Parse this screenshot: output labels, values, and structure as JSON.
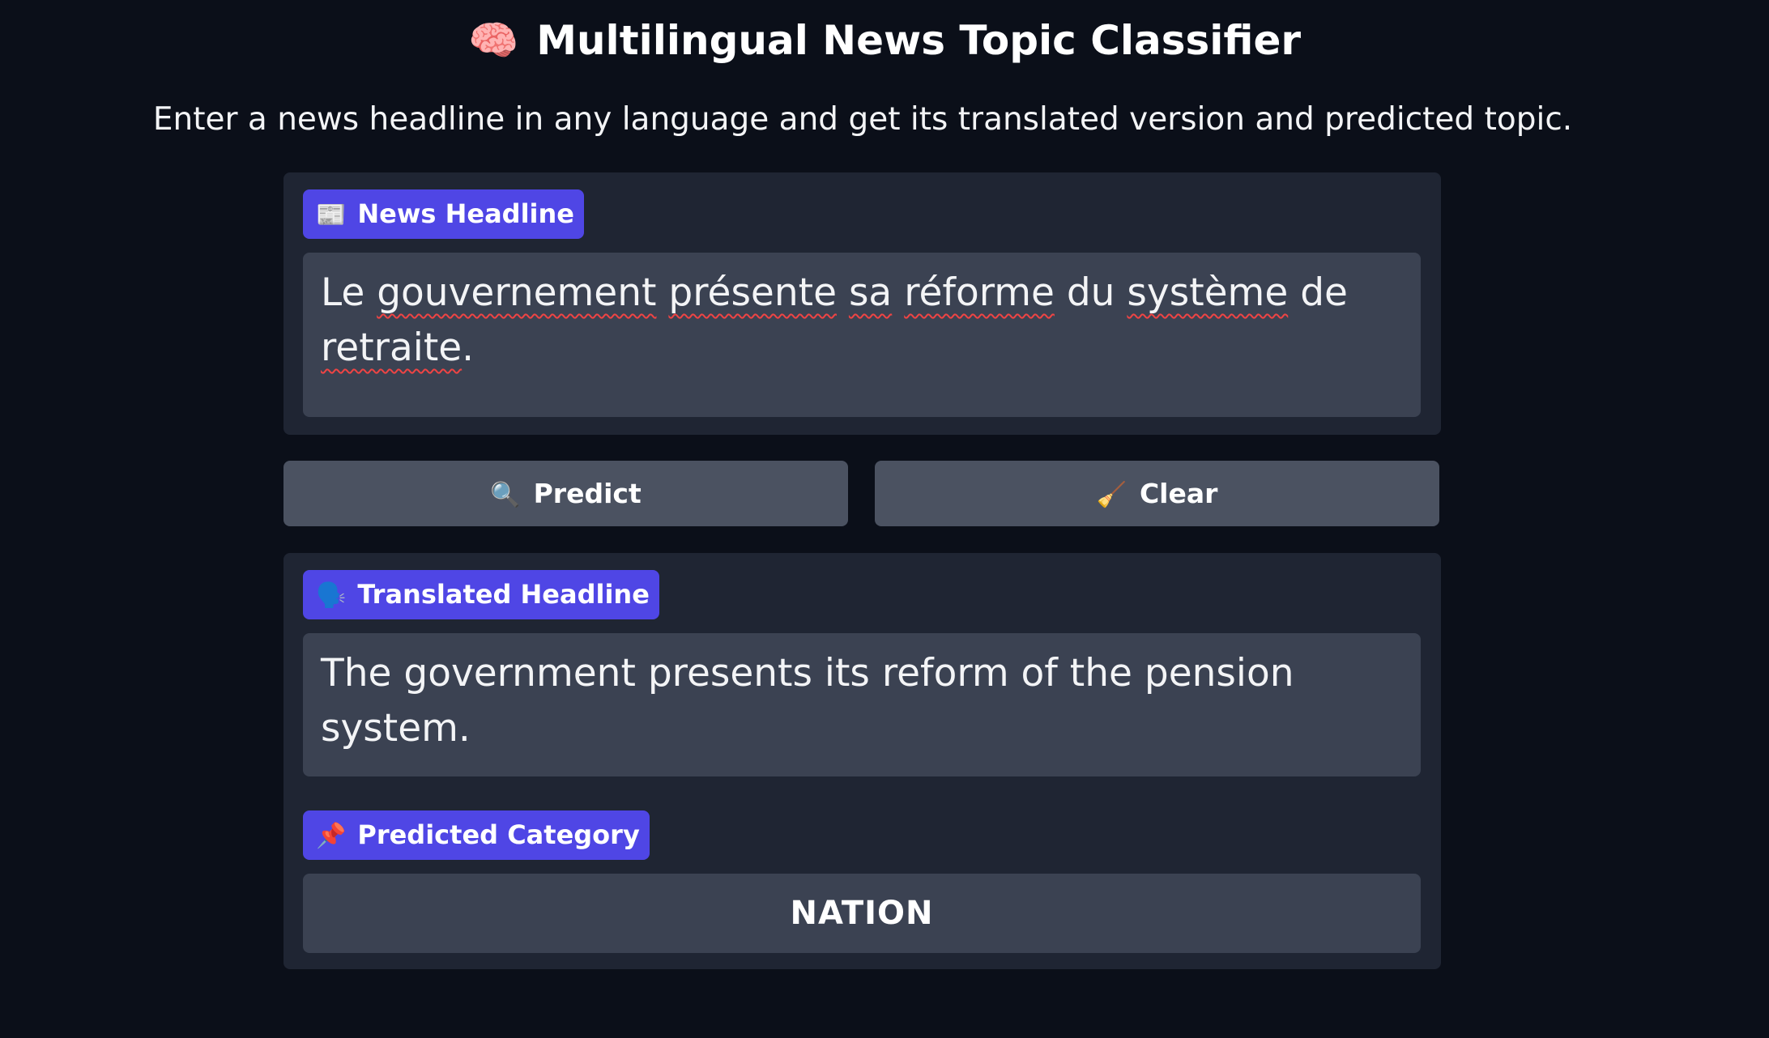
{
  "header": {
    "icon": "brain-icon",
    "icon_glyph": "🧠",
    "title": "Multilingual News Topic Classifier",
    "subtitle": "Enter a news headline in any language and get its translated version and predicted topic."
  },
  "input_section": {
    "label_icon": "newspaper-icon",
    "label_glyph": "📰",
    "label": "News Headline",
    "value_words": [
      {
        "text": "Le ",
        "spell": false
      },
      {
        "text": "gouvernement",
        "spell": true
      },
      {
        "text": " ",
        "spell": false
      },
      {
        "text": "présente",
        "spell": true
      },
      {
        "text": " ",
        "spell": false
      },
      {
        "text": "sa",
        "spell": true
      },
      {
        "text": " ",
        "spell": false
      },
      {
        "text": "réforme",
        "spell": true
      },
      {
        "text": " du ",
        "spell": false
      },
      {
        "text": "système",
        "spell": true
      },
      {
        "text": " de ",
        "spell": false
      },
      {
        "text": "retraite",
        "spell": true
      },
      {
        "text": ".",
        "spell": false
      }
    ]
  },
  "actions": {
    "predict_icon": "magnifier-icon",
    "predict_glyph": "🔍",
    "predict_label": "Predict",
    "clear_icon": "broom-icon",
    "clear_glyph": "🧹",
    "clear_label": "Clear"
  },
  "output_section": {
    "translated_icon": "speaking-head-icon",
    "translated_glyph": "🗣️",
    "translated_label": "Translated Headline",
    "translated_text": "The government presents its reform of the pension system.",
    "category_icon": "pushpin-icon",
    "category_glyph": "📌",
    "category_label": "Predicted Category",
    "category_value": "NATION"
  },
  "colors": {
    "background": "#0b0f19",
    "panel": "#1f2533",
    "field": "#3b4252",
    "button": "#4b5261",
    "label_accent": "#4f46e5",
    "spellcheck": "#ef4444"
  }
}
